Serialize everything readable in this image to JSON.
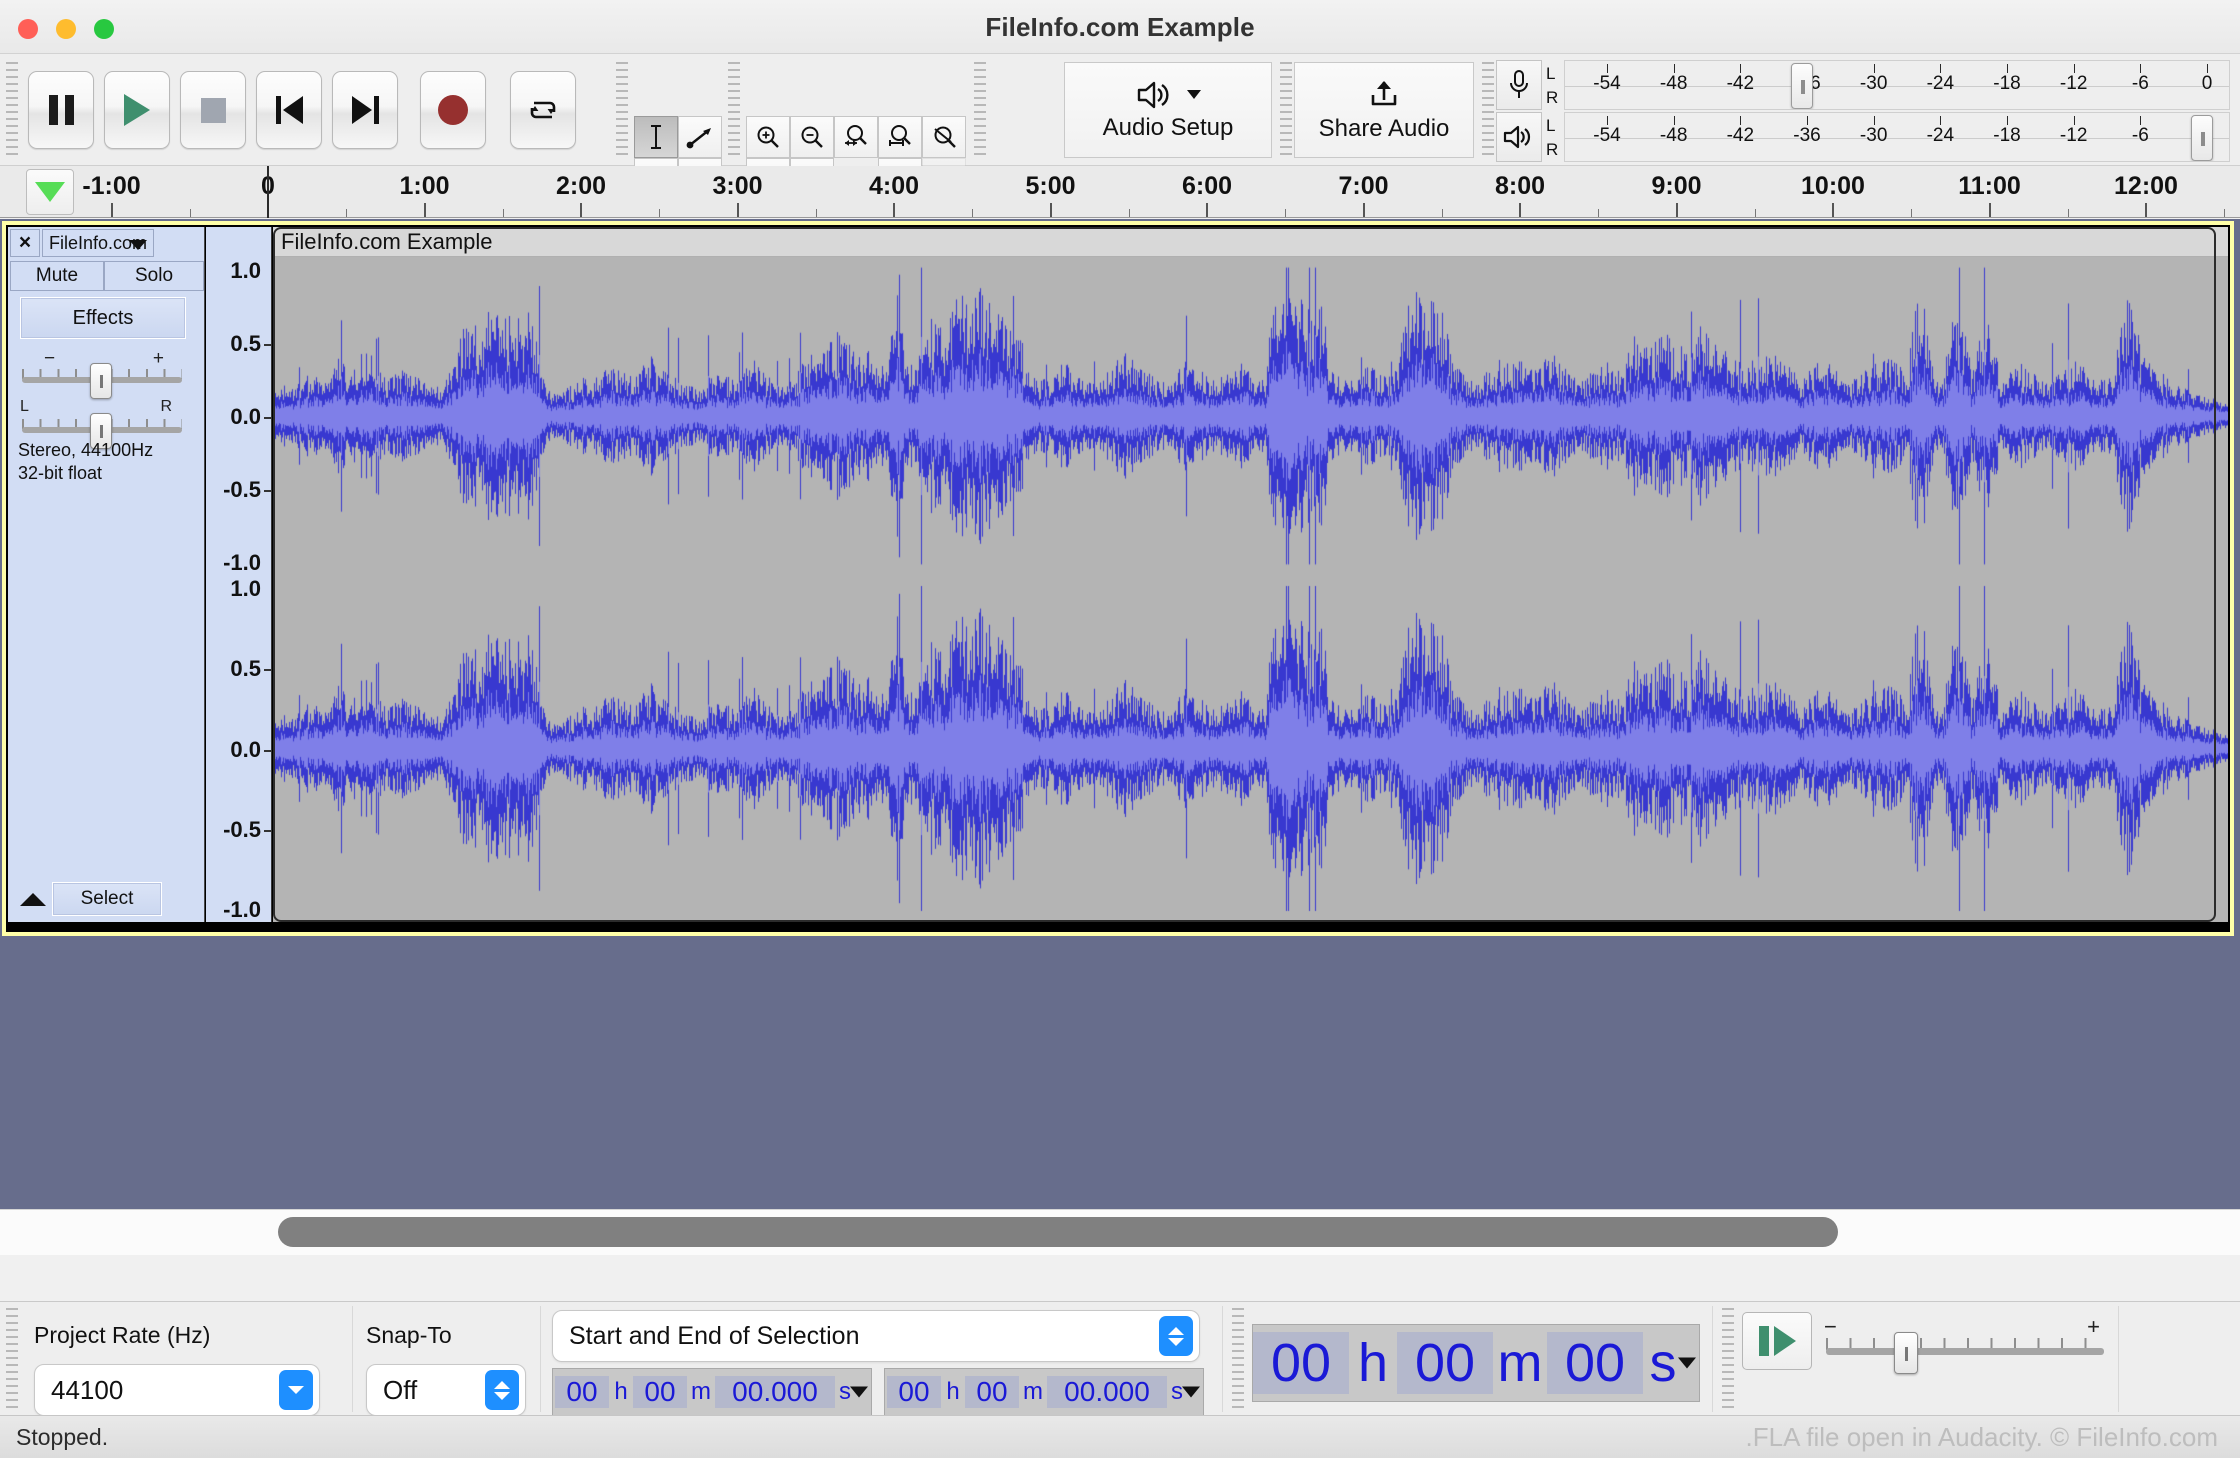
{
  "window": {
    "title": "FileInfo.com Example",
    "traffic_lights": [
      "close",
      "minimize",
      "maximize"
    ]
  },
  "transport": {
    "buttons": [
      {
        "name": "pause",
        "label": "Pause"
      },
      {
        "name": "play",
        "label": "Play"
      },
      {
        "name": "stop",
        "label": "Stop"
      },
      {
        "name": "skip-to-start",
        "label": "Skip to Start"
      },
      {
        "name": "skip-to-end",
        "label": "Skip to End"
      },
      {
        "name": "record",
        "label": "Record"
      },
      {
        "name": "loop",
        "label": "Loop"
      }
    ]
  },
  "tools": {
    "row1": [
      {
        "name": "selection-tool",
        "icon": "i-beam-icon",
        "selected": true
      },
      {
        "name": "envelope-tool",
        "icon": "envelope-icon",
        "selected": false
      }
    ],
    "row2": [
      {
        "name": "draw-tool",
        "icon": "pencil-icon",
        "selected": false
      },
      {
        "name": "multi-tool",
        "icon": "asterisk-icon",
        "selected": false
      }
    ]
  },
  "edit_tools": {
    "row1": [
      {
        "name": "zoom-in",
        "icon": "zoom-in-icon",
        "enabled": true
      },
      {
        "name": "zoom-out",
        "icon": "zoom-out-icon",
        "enabled": true
      },
      {
        "name": "fit-selection",
        "icon": "fit-selection-icon",
        "enabled": true
      },
      {
        "name": "fit-project",
        "icon": "fit-project-icon",
        "enabled": true
      },
      {
        "name": "zoom-toggle",
        "icon": "zoom-toggle-icon",
        "enabled": true
      }
    ],
    "row2": [
      {
        "name": "trim-audio",
        "icon": "trim-audio-icon",
        "enabled": true
      },
      {
        "name": "silence-audio",
        "icon": "silence-audio-icon",
        "enabled": true
      },
      {
        "name": "spacer",
        "icon": "",
        "enabled": true
      },
      {
        "name": "undo",
        "icon": "undo-icon",
        "enabled": true
      },
      {
        "name": "redo",
        "icon": "redo-icon",
        "enabled": false
      }
    ]
  },
  "audio_setup": {
    "label": "Audio Setup",
    "icon": "speaker-icon"
  },
  "share_audio": {
    "label": "Share Audio",
    "icon": "upload-icon"
  },
  "meters": {
    "record": {
      "icon": "microphone-icon",
      "channels": [
        "L",
        "R"
      ],
      "scale": [
        "-54",
        "-48",
        "-42",
        "-36",
        "-30",
        "-24",
        "-18",
        "-12",
        "-6",
        "0"
      ],
      "thumb_position_label": "-30"
    },
    "playback": {
      "icon": "speaker-icon",
      "channels": [
        "L",
        "R"
      ],
      "scale": [
        "-54",
        "-48",
        "-42",
        "-36",
        "-30",
        "-24",
        "-18",
        "-12",
        "-6",
        "0"
      ],
      "thumb_position_label": "0"
    }
  },
  "timeline": {
    "pin_icon": "pinned-play-head-icon",
    "labels": [
      "-1:00",
      "0",
      "1:00",
      "2:00",
      "3:00",
      "4:00",
      "5:00",
      "6:00",
      "7:00",
      "8:00",
      "9:00",
      "10:00",
      "11:00",
      "12:00"
    ]
  },
  "track": {
    "close_label": "×",
    "name": "FileInfo.com",
    "mute_label": "Mute",
    "solo_label": "Solo",
    "effects_label": "Effects",
    "gain_slider": {
      "min_label": "−",
      "max_label": "+"
    },
    "pan_slider": {
      "min_label": "L",
      "max_label": "R"
    },
    "info_line1": "Stereo, 44100Hz",
    "info_line2": "32-bit float",
    "select_label": "Select",
    "collapse_icon": "collapse-up-icon",
    "clip_title": "FileInfo.com Example",
    "vertical_ruler_labels": [
      "1.0",
      "0.5",
      "0.0",
      "-0.5",
      "-1.0"
    ],
    "waveform_color": "#3838d0",
    "waveform_rms_color": "#7f7fe8",
    "waveform_bg": "#b4b4b4"
  },
  "bottom": {
    "project_rate_label": "Project Rate (Hz)",
    "project_rate_value": "44100",
    "snap_to_label": "Snap-To",
    "snap_to_value": "Off",
    "selection_mode": "Start and End of Selection",
    "selection_start": {
      "h": "00",
      "m": "00",
      "s": "00.000",
      "h_unit": "h",
      "m_unit": "m",
      "s_unit": "s"
    },
    "selection_end": {
      "h": "00",
      "m": "00",
      "s": "00.000",
      "h_unit": "h",
      "m_unit": "m",
      "s_unit": "s"
    },
    "audio_position": {
      "h": "00",
      "m": "00",
      "s": "00",
      "h_unit": "h",
      "m_unit": "m",
      "s_unit": "s"
    },
    "play_at_speed_icon": "play-at-speed-icon",
    "speed_slider": {
      "min_label": "−",
      "max_label": "+"
    }
  },
  "status": {
    "left": "Stopped.",
    "right": ".FLA file open in Audacity. © FileInfo.com"
  },
  "waveform_data": {
    "type": "area",
    "description": "Stereo audio waveform, two identical channels",
    "peak_envelope": [
      0.12,
      0.16,
      0.14,
      0.18,
      0.22,
      0.2,
      0.17,
      0.33,
      0.21,
      0.28,
      0.38,
      0.24,
      0.19,
      0.22,
      0.26,
      0.21,
      0.17,
      0.15,
      0.19,
      0.23,
      0.48,
      0.52,
      0.47,
      0.55,
      0.5,
      0.53,
      0.49,
      0.54,
      0.46,
      0.13,
      0.11,
      0.14,
      0.17,
      0.21,
      0.19,
      0.24,
      0.28,
      0.23,
      0.2,
      0.26,
      0.31,
      0.25,
      0.22,
      0.18,
      0.16,
      0.14,
      0.19,
      0.23,
      0.21,
      0.17,
      0.24,
      0.29,
      0.22,
      0.18,
      0.15,
      0.2,
      0.26,
      0.34,
      0.3,
      0.38,
      0.44,
      0.36,
      0.32,
      0.4,
      0.28,
      0.24,
      0.66,
      0.3,
      0.26,
      0.52,
      0.48,
      0.44,
      0.58,
      0.62,
      0.56,
      0.68,
      0.6,
      0.54,
      0.5,
      0.46,
      0.22,
      0.18,
      0.2,
      0.24,
      0.28,
      0.23,
      0.19,
      0.17,
      0.21,
      0.26,
      0.33,
      0.29,
      0.25,
      0.21,
      0.18,
      0.16,
      0.24,
      0.3,
      0.27,
      0.22,
      0.19,
      0.23,
      0.28,
      0.25,
      0.21,
      0.18,
      0.61,
      0.57,
      0.64,
      0.59,
      0.55,
      0.62,
      0.24,
      0.2,
      0.17,
      0.22,
      0.27,
      0.23,
      0.19,
      0.25,
      0.58,
      0.63,
      0.57,
      0.61,
      0.55,
      0.26,
      0.22,
      0.18,
      0.2,
      0.24,
      0.29,
      0.26,
      0.31,
      0.27,
      0.23,
      0.34,
      0.3,
      0.26,
      0.22,
      0.19,
      0.24,
      0.28,
      0.25,
      0.21,
      0.42,
      0.38,
      0.35,
      0.44,
      0.4,
      0.36,
      0.32,
      0.46,
      0.41,
      0.37,
      0.33,
      0.29,
      0.25,
      0.3,
      0.35,
      0.31,
      0.27,
      0.23,
      0.2,
      0.25,
      0.29,
      0.26,
      0.22,
      0.18,
      0.21,
      0.24,
      0.28,
      0.31,
      0.27,
      0.23,
      0.56,
      0.61,
      0.2,
      0.24,
      0.52,
      0.48,
      0.21,
      0.45,
      0.5,
      0.19,
      0.23,
      0.27,
      0.24,
      0.2,
      0.17,
      0.22,
      0.26,
      0.29,
      0.25,
      0.21,
      0.18,
      0.23,
      0.64,
      0.58,
      0.31,
      0.27,
      0.23,
      0.19,
      0.16,
      0.14,
      0.12,
      0.1,
      0.08,
      0.06
    ],
    "rms_ratio": 0.4
  }
}
